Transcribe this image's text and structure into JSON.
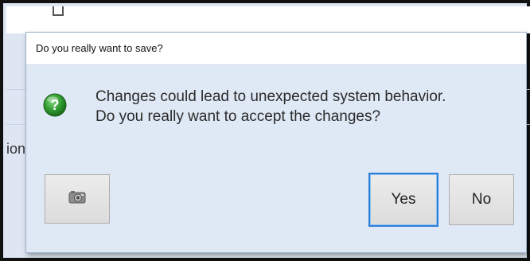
{
  "background": {
    "fragment_text": "ion"
  },
  "dialog": {
    "title": "Do you really want to save?",
    "icon": "question-icon",
    "message_line1": "Changes could lead to unexpected system behavior.",
    "message_line2": "Do you really want to accept the changes?",
    "buttons": {
      "screenshot_icon": "camera-icon",
      "yes_label": "Yes",
      "no_label": "No"
    }
  },
  "colors": {
    "dialog_bg": "#dfe9f5",
    "focus_border": "#2f7fd9",
    "question_icon_green": "#2e9a2e"
  }
}
